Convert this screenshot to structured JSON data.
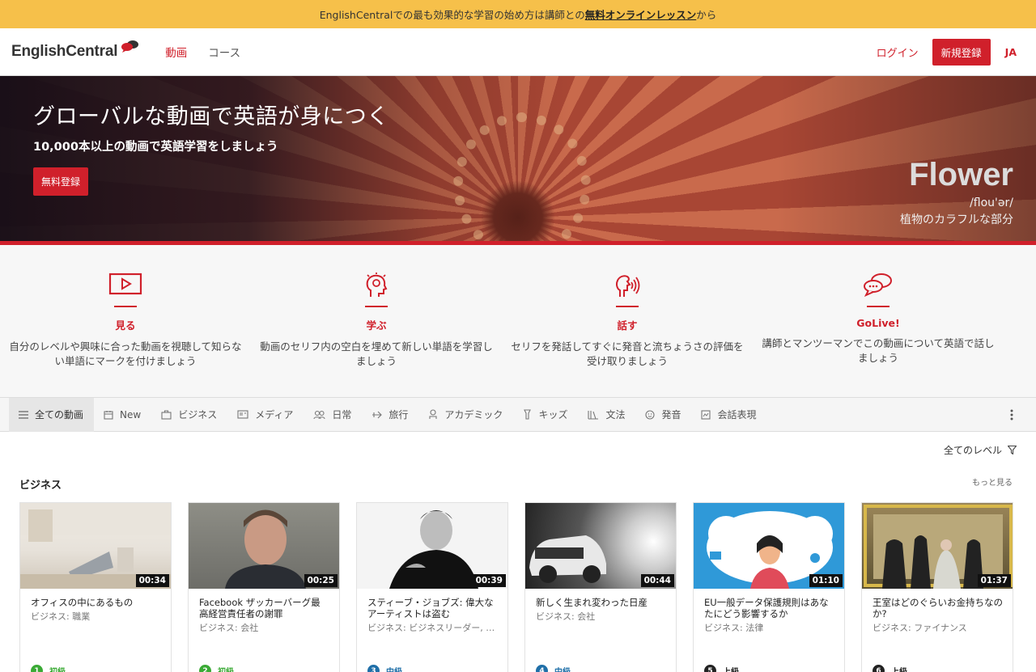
{
  "promo": {
    "text_before": "EnglishCentralでの最も効果的な学習の始め方は講師との",
    "link": "無料オンラインレッスン",
    "text_after": "から"
  },
  "header": {
    "logo": "EnglishCentral",
    "nav": [
      "動画",
      "コース"
    ],
    "login": "ログイン",
    "signup": "新規登録",
    "lang": "JA"
  },
  "hero": {
    "title": "グローバルな動画で英語が身につく",
    "subtitle": "10,000本以上の動画で英語学習をしましょう",
    "button": "無料登録",
    "word": "Flower",
    "phonetic": "/flou'ər/",
    "definition": "植物のカラフルな部分"
  },
  "features": [
    {
      "icon": "play-screen-icon",
      "title": "見る",
      "desc": "自分のレベルや興味に合った動画を視聴して知らない単語にマークを付けましょう"
    },
    {
      "icon": "lightbulb-head-icon",
      "title": "学ぶ",
      "desc": "動画のセリフ内の空白を埋めて新しい単語を学習しましょう"
    },
    {
      "icon": "speaking-head-icon",
      "title": "話す",
      "desc": "セリフを発話してすぐに発音と流ちょうさの評価を受け取りましょう"
    },
    {
      "icon": "chat-bubbles-icon",
      "title": "GoLive!",
      "desc": "講師とマンツーマンでこの動画について英語で話しましょう"
    }
  ],
  "categories": [
    {
      "label": "全ての動画",
      "icon": "list-icon"
    },
    {
      "label": "New",
      "icon": "calendar-icon"
    },
    {
      "label": "ビジネス",
      "icon": "briefcase-icon"
    },
    {
      "label": "メディア",
      "icon": "media-icon"
    },
    {
      "label": "日常",
      "icon": "people-icon"
    },
    {
      "label": "旅行",
      "icon": "plane-icon"
    },
    {
      "label": "アカデミック",
      "icon": "academic-icon"
    },
    {
      "label": "キッズ",
      "icon": "kids-icon"
    },
    {
      "label": "文法",
      "icon": "books-icon"
    },
    {
      "label": "発音",
      "icon": "smile-icon"
    },
    {
      "label": "会話表現",
      "icon": "conversation-icon"
    }
  ],
  "filter": {
    "level": "全てのレベル"
  },
  "section": {
    "title": "ビジネス",
    "more": "もっと見る"
  },
  "cards": [
    {
      "duration": "00:34",
      "title": "オフィスの中にあるもの",
      "subtitle": "ビジネス: 職業",
      "level_num": "1",
      "level": "初級",
      "level_color": "#3aaa35"
    },
    {
      "duration": "00:25",
      "title": "Facebook ザッカーバーグ最高経営責任者の謝罪",
      "subtitle": "ビジネス: 会社",
      "level_num": "2",
      "level": "初級",
      "level_color": "#3aaa35"
    },
    {
      "duration": "00:39",
      "title": "スティーブ・ジョブズ: 偉大なアーティストは盗む",
      "subtitle": "ビジネス: ビジネスリーダー, イ...",
      "level_num": "3",
      "level": "中級",
      "level_color": "#1f6fa8"
    },
    {
      "duration": "00:44",
      "title": "新しく生まれ変わった日産",
      "subtitle": "ビジネス: 会社",
      "level_num": "4",
      "level": "中級",
      "level_color": "#1f6fa8"
    },
    {
      "duration": "01:10",
      "title": "EU一般データ保護規則はあなたにどう影響するか",
      "subtitle": "ビジネス: 法律",
      "level_num": "5",
      "level": "上級",
      "level_color": "#222222"
    },
    {
      "duration": "01:37",
      "title": "王室はどのぐらいお金持ちなのか?",
      "subtitle": "ビジネス: ファイナンス",
      "level_num": "6",
      "level": "上級",
      "level_color": "#222222"
    }
  ]
}
